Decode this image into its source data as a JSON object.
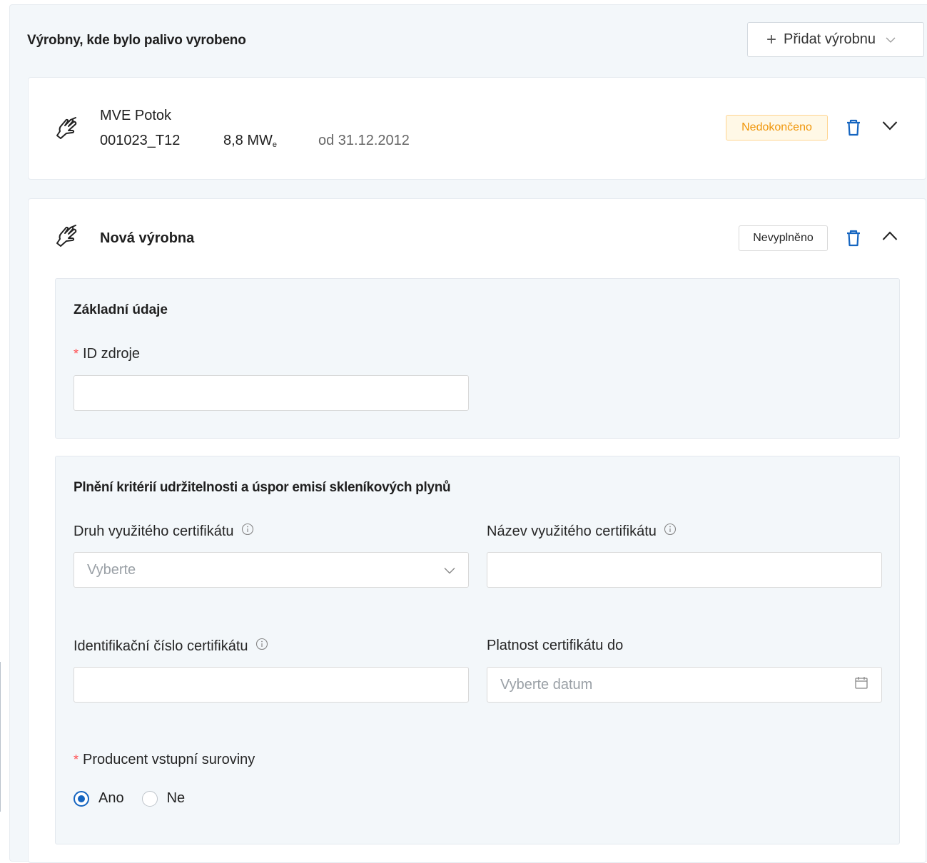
{
  "section": {
    "title": "Výrobny, kde bylo palivo vyrobeno",
    "add_button": "Přidat výrobnu"
  },
  "plants": [
    {
      "name": "MVE Potok",
      "id": "001023_T12",
      "power": "8,8 MW",
      "power_sub": "e",
      "since": "od 31.12.2012",
      "status": "Nedokončeno"
    }
  ],
  "new_plant": {
    "name": "Nová výrobna",
    "status": "Nevyplněno",
    "basic": {
      "title": "Základní údaje",
      "id_label": "ID zdroje",
      "id_value": ""
    },
    "criteria": {
      "title": "Plnění kritérií udržitelnosti a úspor emisí skleníkových plynů",
      "cert_type_label": "Druh využitého certifikátu",
      "cert_type_placeholder": "Vyberte",
      "cert_name_label": "Název využitého certifikátu",
      "cert_name_value": "",
      "cert_number_label": "Identifikační číslo certifikátu",
      "cert_number_value": "",
      "cert_validity_label": "Platnost certifikátu do",
      "cert_validity_placeholder": "Vyberte datum",
      "producer_label": "Producent vstupní suroviny",
      "producer_options": [
        "Ano",
        "Ne"
      ],
      "producer_selected": "Ano"
    }
  },
  "colors": {
    "accent": "#1565c0",
    "warning_text": "#f0960a",
    "warning_bg": "#fff8e6",
    "panel_bg": "#f3f7fa",
    "required": "#ff4d4f"
  }
}
